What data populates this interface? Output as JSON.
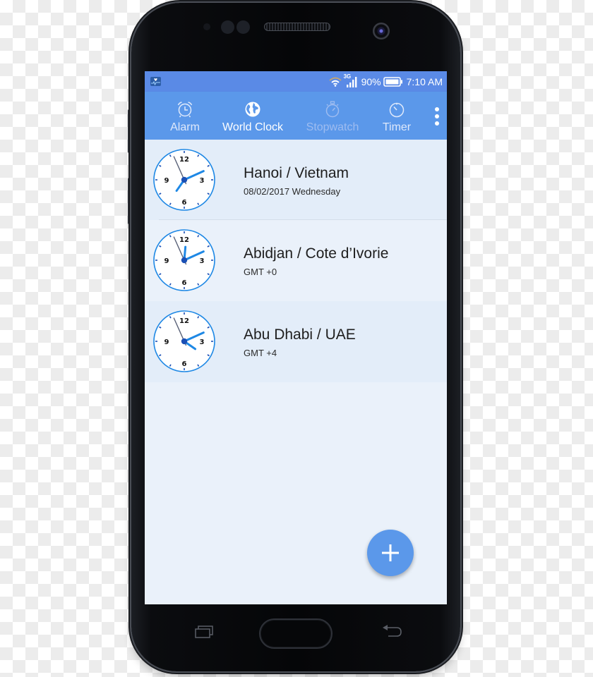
{
  "status_bar": {
    "notification_icon": "health-app-icon",
    "network_type": "3G",
    "battery_percent": "90%",
    "time": "7:10 AM"
  },
  "tabs": [
    {
      "label": "Alarm",
      "icon": "alarm-clock-icon",
      "state": "inactive"
    },
    {
      "label": "World Clock",
      "icon": "globe-icon",
      "state": "active"
    },
    {
      "label": "Stopwatch",
      "icon": "stopwatch-icon",
      "state": "disabled"
    },
    {
      "label": "Timer",
      "icon": "timer-icon",
      "state": "inactive"
    }
  ],
  "overflow_menu_icon": "more-vert-icon",
  "clocks": [
    {
      "city": "Hanoi / Vietnam",
      "subtitle": "08/02/2017 Wednesday",
      "time": "7:10",
      "hour": 7,
      "minute": 10,
      "second": 56
    },
    {
      "city": "Abidjan / Cote d’Ivorie",
      "subtitle": "GMT +0",
      "time": "0:10",
      "hour": 0,
      "minute": 10,
      "second": 56
    },
    {
      "city": "Abu Dhabi / UAE",
      "subtitle": "GMT +4",
      "time": "4:10",
      "hour": 4,
      "minute": 10,
      "second": 56
    }
  ],
  "clock_numerals": [
    "12",
    "3",
    "6",
    "9"
  ],
  "fab": {
    "icon": "plus-icon",
    "label": "+"
  },
  "colors": {
    "status_bar": "#5a8ae6",
    "tab_bar": "#5b98ea",
    "accent_blue": "#1e88e5",
    "hand_dark_blue": "#1a4fb5",
    "second_hand": "#5a6278",
    "row_alt": "#e3edf9",
    "row_plain": "#eaf1fa"
  }
}
